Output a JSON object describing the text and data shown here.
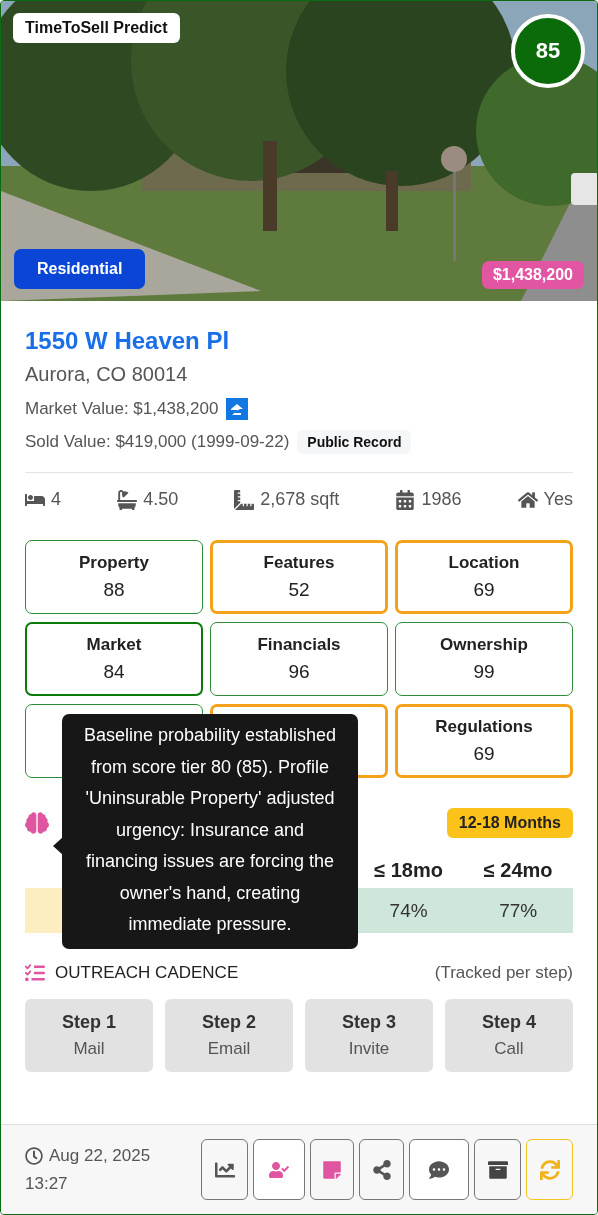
{
  "hero": {
    "brand": "TimeToSell Predict",
    "score": "85",
    "property_type": "Residential",
    "price": "$1,438,200"
  },
  "address": {
    "street": "1550 W Heaven Pl",
    "city": "Aurora, CO 80014"
  },
  "market_value": "Market Value: $1,438,200",
  "sold_value": "Sold Value: $419,000 (1999-09-22)",
  "sold_source": "Public Record",
  "stats": [
    {
      "kind": "beds",
      "value": "4"
    },
    {
      "kind": "baths",
      "value": "4.50"
    },
    {
      "kind": "area",
      "value": "2,678 sqft"
    },
    {
      "kind": "year",
      "value": "1986"
    },
    {
      "kind": "owner",
      "value": "Yes"
    }
  ],
  "scores": [
    {
      "label": "Property",
      "value": "88",
      "color": "#2e8b3a",
      "selected": false
    },
    {
      "label": "Features",
      "value": "52",
      "color": "#f5a21b",
      "selected": false
    },
    {
      "label": "Location",
      "value": "69",
      "color": "#f5a21b",
      "selected": false
    },
    {
      "label": "Market",
      "value": "84",
      "color": "#0b7a0b",
      "selected": true
    },
    {
      "label": "Financials",
      "value": "96",
      "color": "#2e8b3a",
      "selected": false
    },
    {
      "label": "Ownership",
      "value": "99",
      "color": "#2e8b3a",
      "selected": false
    },
    {
      "color": "#2e8b3a",
      "selected": false
    },
    {
      "color": "#f5a21b",
      "selected": false
    },
    {
      "label": "Regulations",
      "value": "69",
      "color": "#f5a21b",
      "selected": false
    }
  ],
  "months": {
    "badge": "12-18 Months",
    "columns": [
      {
        "color": "#fdeec2"
      },
      {},
      {},
      {
        "header": "≤ 18mo",
        "value": "74%",
        "color": "#cfe7da"
      },
      {
        "header": "≤ 24mo",
        "value": "77%",
        "color": "#cfe7da"
      }
    ]
  },
  "tooltip": {
    "text": "Baseline probability established from score tier 80 (85). Profile 'Uninsurable Property' adjusted urgency: Insurance and financing issues are forcing the owner's hand, creating immediate pressure."
  },
  "outreach": {
    "title": "OUTREACH CADENCE",
    "note": "(Tracked per step)",
    "steps": [
      {
        "label": "Step 1",
        "channel": "Mail"
      },
      {
        "label": "Step 2",
        "channel": "Email"
      },
      {
        "label": "Step 3",
        "channel": "Invite"
      },
      {
        "label": "Step 4",
        "channel": "Call"
      }
    ]
  },
  "footer": {
    "date": "Aug 22, 2025",
    "time": "13:27",
    "actions": [
      {
        "kind": "chart",
        "highlighted": false
      },
      {
        "kind": "assign",
        "highlighted": false
      },
      {
        "kind": "note",
        "highlighted": false
      },
      {
        "kind": "share",
        "highlighted": false
      },
      {
        "kind": "comment",
        "highlighted": false
      },
      {
        "kind": "archive",
        "highlighted": false
      },
      {
        "kind": "refresh",
        "highlighted": true
      }
    ]
  }
}
